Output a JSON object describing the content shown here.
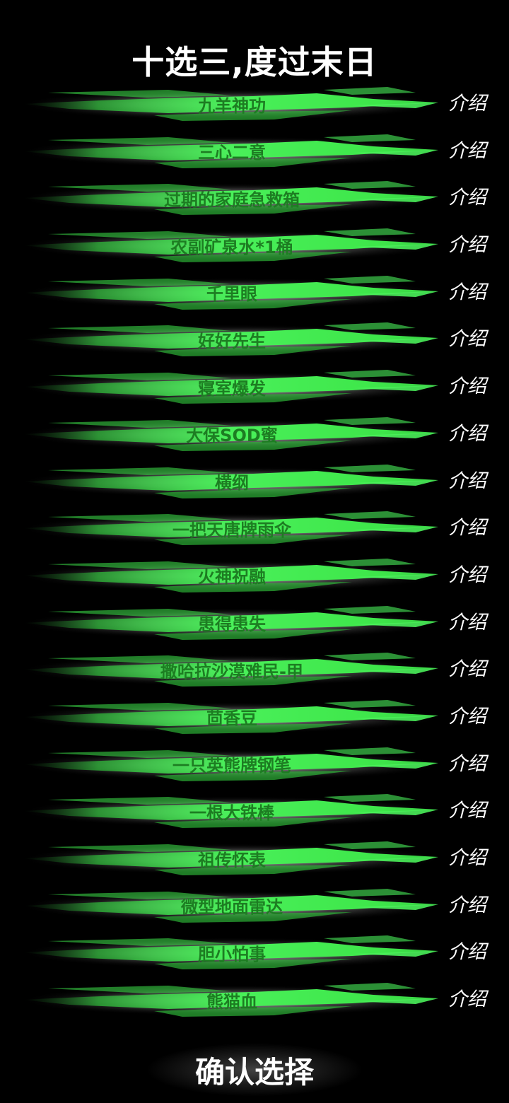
{
  "title": "十选三,度过末日",
  "intro_label": "介绍",
  "confirm_label": "确认选择",
  "colors": {
    "background": "#000000",
    "brush_green": "#3ee64a",
    "item_text": "#1d7d22",
    "text_light": "#ffffff"
  },
  "items": [
    {
      "label": "九羊神功"
    },
    {
      "label": "三心二意"
    },
    {
      "label": "过期的家庭急救箱"
    },
    {
      "label": "农副矿泉水*1桶"
    },
    {
      "label": "千里眼"
    },
    {
      "label": "好好先生"
    },
    {
      "label": "寝室爆发"
    },
    {
      "label": "大保SOD蜜"
    },
    {
      "label": "横纲"
    },
    {
      "label": "一把天唐牌雨伞"
    },
    {
      "label": "火神祝融"
    },
    {
      "label": "患得患失"
    },
    {
      "label": "撒哈拉沙漠难民-甲"
    },
    {
      "label": "茴香豆"
    },
    {
      "label": "一只英熊牌钢笔"
    },
    {
      "label": "一根大铁棒"
    },
    {
      "label": "祖传怀表"
    },
    {
      "label": "微型地面雷达"
    },
    {
      "label": "胆小怕事"
    },
    {
      "label": "熊猫血"
    }
  ]
}
